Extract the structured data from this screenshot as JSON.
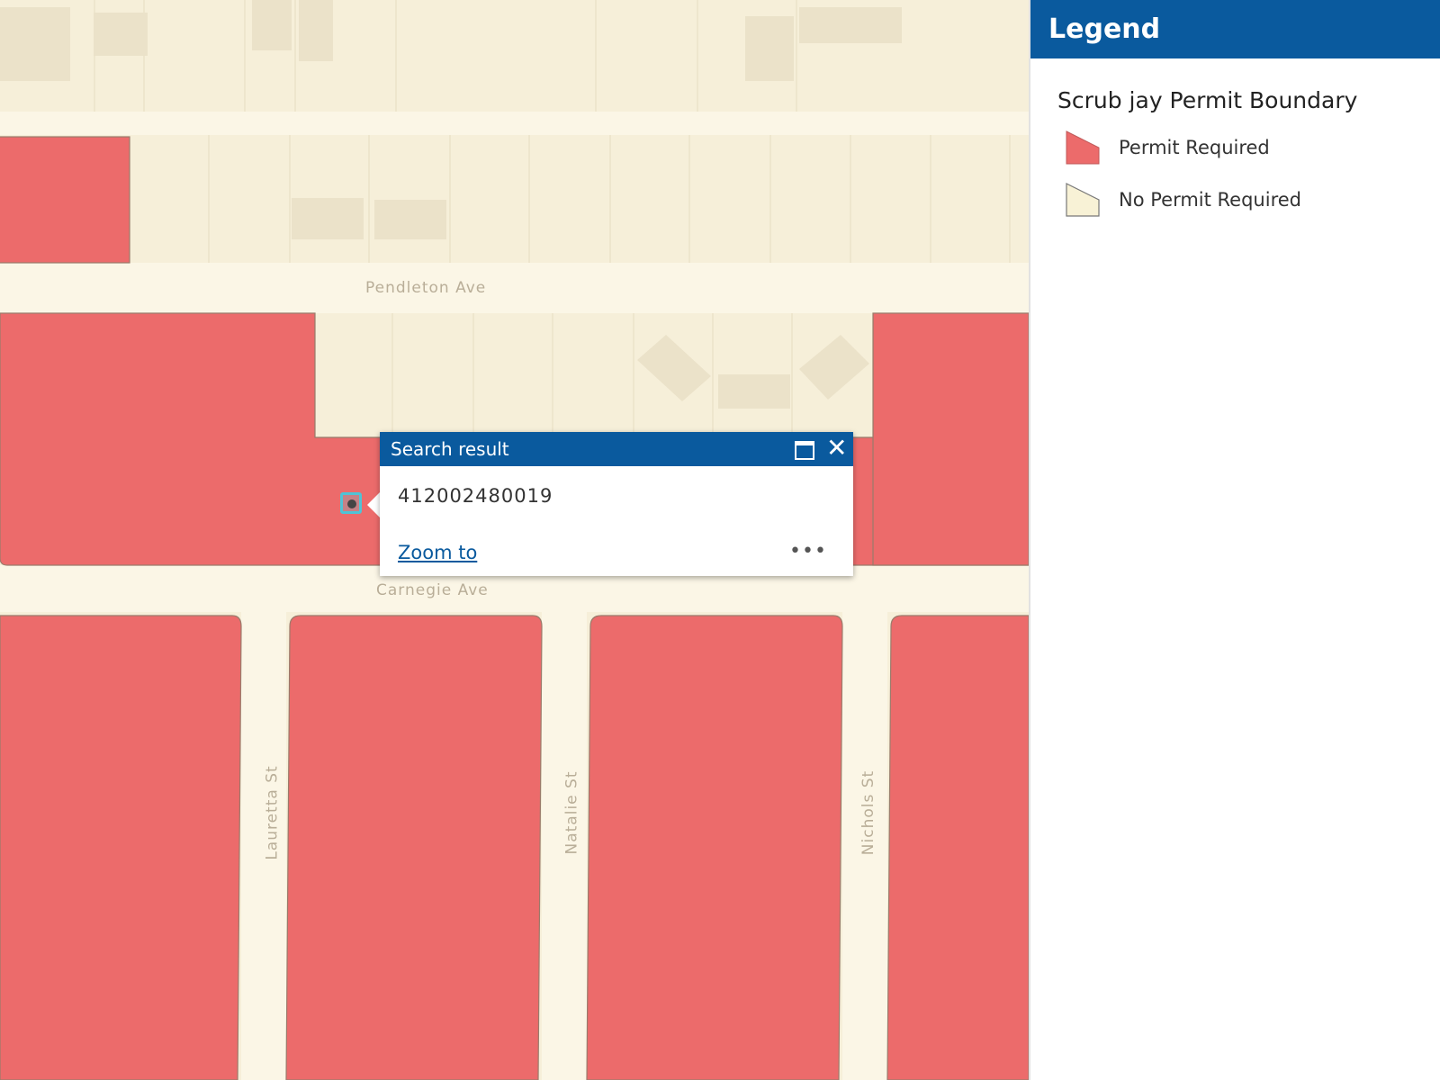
{
  "map": {
    "streets": {
      "pendleton": "Pendleton Ave",
      "carnegie": "Carnegie Ave",
      "lauretta": "Lauretta St",
      "natalie": "Natalie St",
      "nichols": "Nichols St"
    },
    "colors": {
      "permit_required": "#ec6b6b",
      "no_permit": "#f6efd9",
      "road": "#fbf6e6",
      "building": "#e8dfc7"
    }
  },
  "popup": {
    "title": "Search result",
    "value": "412002480019",
    "zoom_label": "Zoom to",
    "more_label": "•••",
    "close_label": "✕"
  },
  "legend": {
    "title": "Legend",
    "layer_title": "Scrub jay Permit Boundary",
    "items": [
      {
        "label": "Permit Required",
        "color": "#ec6b6b"
      },
      {
        "label": "No Permit Required",
        "color": "#f8f2d6"
      }
    ]
  }
}
